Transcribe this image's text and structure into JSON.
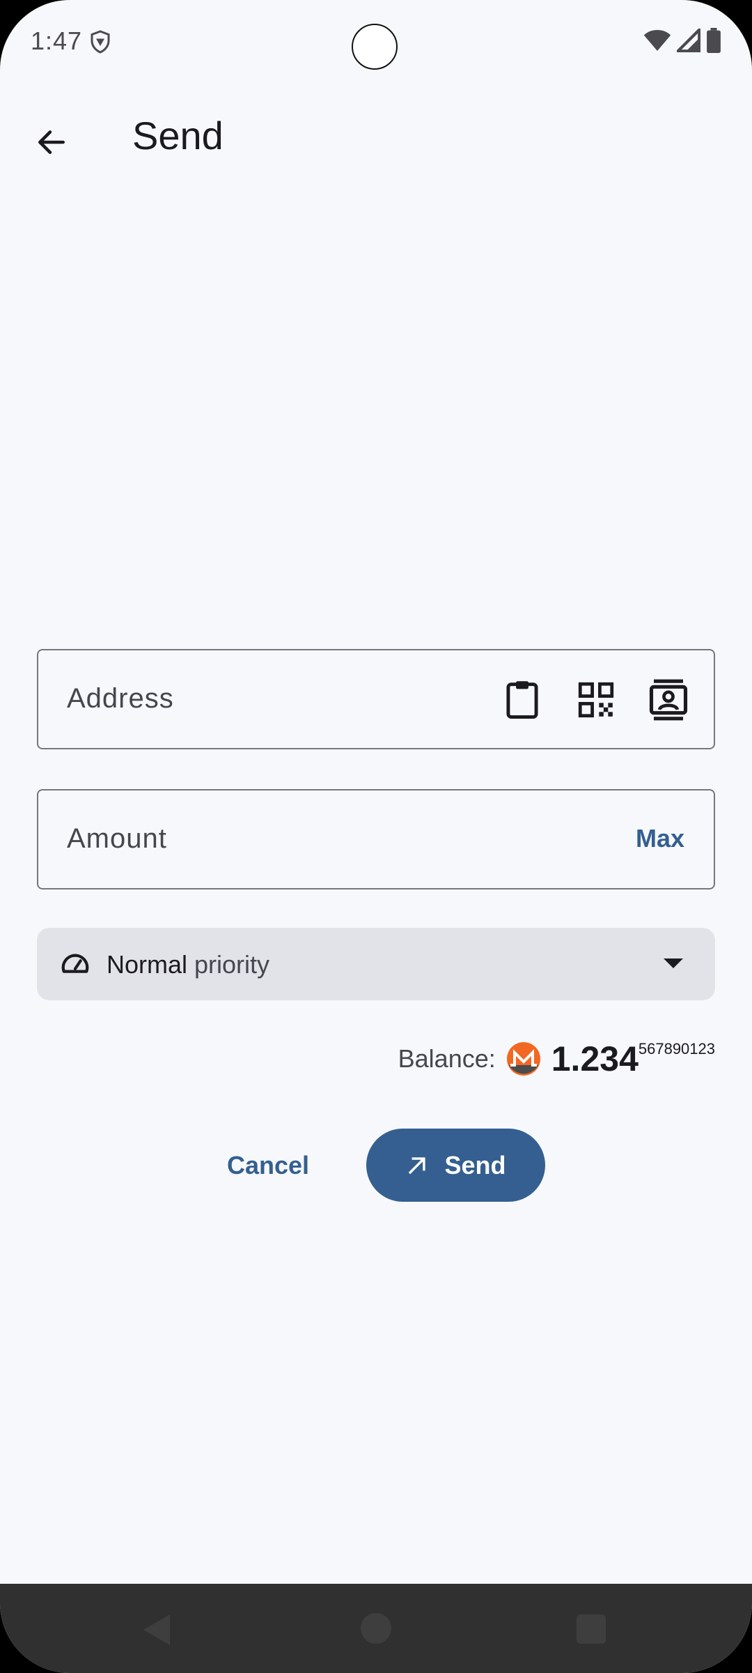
{
  "status_bar": {
    "time": "1:47"
  },
  "app_bar": {
    "title": "Send"
  },
  "address_field": {
    "label": "Address",
    "icons": [
      "clipboard-icon",
      "qr-code-icon",
      "address-book-icon"
    ]
  },
  "amount_field": {
    "label": "Amount",
    "max_label": "Max"
  },
  "priority": {
    "selected": "Normal",
    "suffix": " priority",
    "icon": "speedometer-icon"
  },
  "balance": {
    "label": "Balance:",
    "main": "1.234",
    "fraction": "567890123",
    "currency_icon": "monero-icon"
  },
  "actions": {
    "cancel_label": "Cancel",
    "send_label": "Send"
  },
  "colors": {
    "primary": "#345f90",
    "background": "#f7f8fc",
    "surface_variant": "#e2e3e8",
    "outline": "#74777f",
    "monero_orange": "#f26822"
  }
}
